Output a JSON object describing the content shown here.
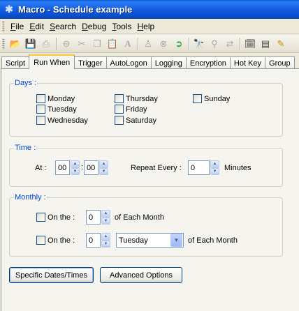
{
  "window": {
    "title": "Macro - Schedule example",
    "icon": "macro-app-icon"
  },
  "menu": [
    {
      "label": "File",
      "key": "F",
      "rest": "ile"
    },
    {
      "label": "Edit",
      "key": "E",
      "rest": "dit"
    },
    {
      "label": "Search",
      "key": "S",
      "rest": "earch"
    },
    {
      "label": "Debug",
      "key": "D",
      "rest": "ebug"
    },
    {
      "label": "Tools",
      "key": "T",
      "rest": "ools"
    },
    {
      "label": "Help",
      "key": "H",
      "rest": "elp"
    }
  ],
  "toolbar_icons": [
    "open-folder-icon",
    "save-icon",
    "print-icon",
    "stop-icon",
    "cut-icon",
    "copy-icon",
    "paste-icon",
    "font-icon",
    "record-icon",
    "cancel-icon",
    "play-icon",
    "find-icon",
    "find-next-icon",
    "replace-icon",
    "schedule-icon",
    "variables-icon",
    "edit-icon"
  ],
  "tabs": [
    "Script",
    "Run When",
    "Trigger",
    "AutoLogon",
    "Logging",
    "Encryption",
    "Hot Key",
    "Group"
  ],
  "active_tab": "Run When",
  "days": {
    "label": "Days :",
    "items": [
      {
        "label": "Monday",
        "checked": false
      },
      {
        "label": "Tuesday",
        "checked": false
      },
      {
        "label": "Wednesday",
        "checked": false
      },
      {
        "label": "Thursday",
        "checked": false
      },
      {
        "label": "Friday",
        "checked": false
      },
      {
        "label": "Saturday",
        "checked": false
      },
      {
        "label": "Sunday",
        "checked": false
      }
    ]
  },
  "time": {
    "label": "Time :",
    "at_label": "At :",
    "hour": "00",
    "separator": ":",
    "minute": "00",
    "repeat_label": "Repeat Every :",
    "repeat_value": "0",
    "repeat_unit": "Minutes"
  },
  "monthly": {
    "label": "Monthly :",
    "row1": {
      "label": "On the :",
      "value": "0",
      "suffix": "of Each Month",
      "checked": false
    },
    "row2": {
      "label": "On the :",
      "value": "0",
      "weekday": "Tuesday",
      "suffix": "of Each Month",
      "checked": false
    }
  },
  "buttons": {
    "specific": "Specific Dates/Times",
    "advanced": "Advanced Options"
  },
  "colors": {
    "titlebar": "#0a4fd0",
    "group_label": "#0046d5",
    "active_tab_accent": "#ffc73c"
  }
}
